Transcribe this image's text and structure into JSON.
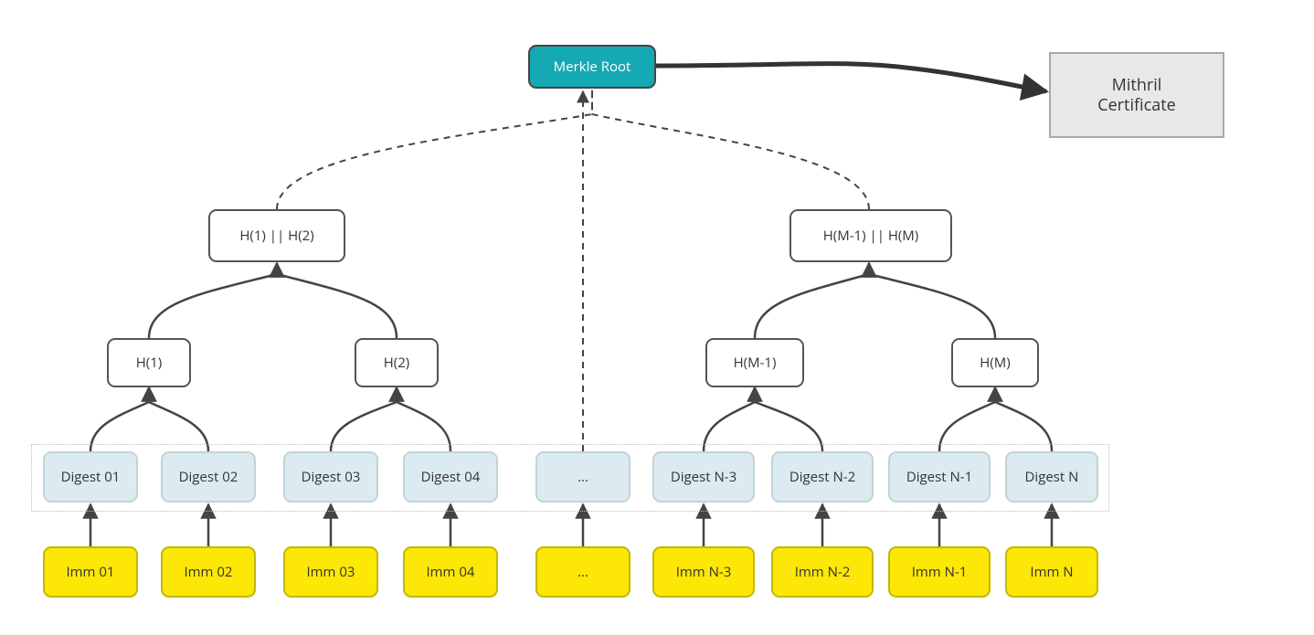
{
  "colors": {
    "root_fill": "#15a9b4",
    "root_border": "#454545",
    "hash_border": "#545454",
    "digest_fill": "#dcebef",
    "digest_border": "#c1d3d8",
    "imm_fill": "#fce706",
    "imm_border": "#c3b707",
    "cert_fill": "#e8e8e8",
    "cert_border": "#a8a8a8"
  },
  "root": {
    "label": "Merkle Root"
  },
  "cert": {
    "line1": "Mithril",
    "line2": "Certificate"
  },
  "internal_pairs": {
    "left": "H(1) || H(2)",
    "right": "H(M-1) || H(M)"
  },
  "internal_hashes": {
    "h1": "H(1)",
    "h2": "H(2)",
    "hm1": "H(M-1)",
    "hm": "H(M)"
  },
  "digests": {
    "d01": "Digest 01",
    "d02": "Digest 02",
    "d03": "Digest 03",
    "d04": "Digest 04",
    "dmid": "...",
    "dn3": "Digest N-3",
    "dn2": "Digest N-2",
    "dn1": "Digest N-1",
    "dn": "Digest N"
  },
  "imms": {
    "i01": "Imm 01",
    "i02": "Imm 02",
    "i03": "Imm 03",
    "i04": "Imm 04",
    "imid": "...",
    "in3": "Imm N-3",
    "in2": "Imm N-2",
    "in1": "Imm N-1",
    "in": "Imm N"
  }
}
